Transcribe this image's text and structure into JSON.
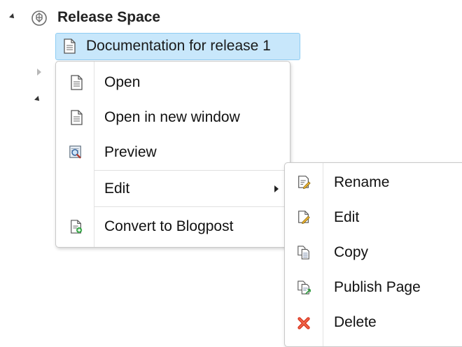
{
  "tree": {
    "space_title": "Release Space",
    "selected_page": "Documentation for release 1"
  },
  "context_menu": {
    "items": [
      {
        "label": "Open",
        "icon": "page-icon"
      },
      {
        "label": "Open in new window",
        "icon": "page-icon"
      },
      {
        "label": "Preview",
        "icon": "preview-icon"
      },
      {
        "label": "Edit",
        "icon": "",
        "has_submenu": true
      },
      {
        "label": "Convert to Blogpost",
        "icon": "convert-blogpost-icon"
      }
    ]
  },
  "edit_submenu": {
    "items": [
      {
        "label": "Rename",
        "icon": "rename-icon"
      },
      {
        "label": "Edit",
        "icon": "edit-icon"
      },
      {
        "label": "Copy",
        "icon": "copy-icon"
      },
      {
        "label": "Publish Page",
        "icon": "publish-page-icon"
      },
      {
        "label": "Delete",
        "icon": "delete-icon"
      }
    ]
  },
  "colors": {
    "selection_bg": "#c8e7fb",
    "selection_border": "#8fcdf3",
    "delete_red": "#d9341f"
  }
}
